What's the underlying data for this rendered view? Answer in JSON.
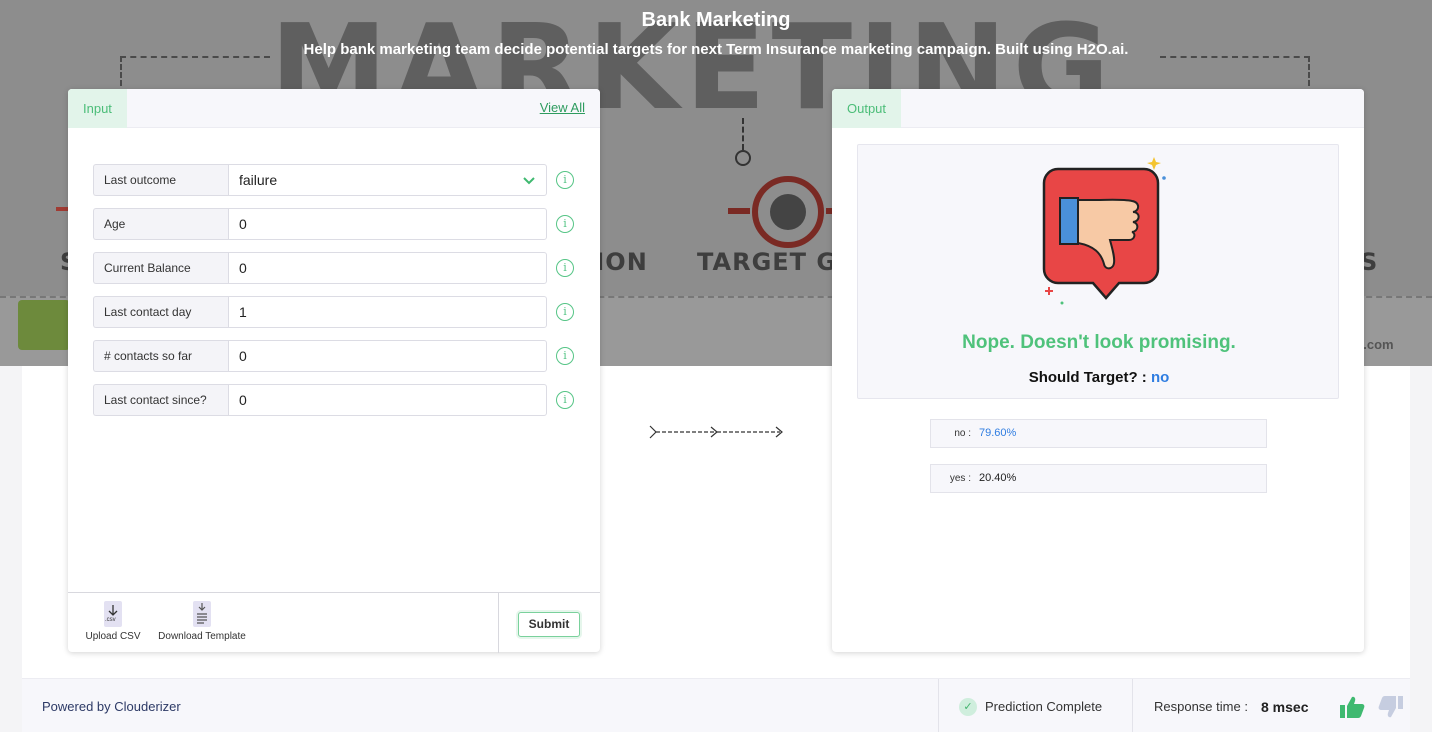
{
  "header": {
    "title": "Bank Marketing",
    "subtitle": "Help bank marketing team decide potential targets for next Term Insurance marketing campaign. Built using H2O.ai."
  },
  "hero": {
    "big_word": "MARKETING",
    "words": [
      "S",
      "TION",
      "TARGET GR",
      "S"
    ],
    "url_fragment": "e.com"
  },
  "input_panel": {
    "tab_label": "Input",
    "view_all": "View All",
    "fields": [
      {
        "label": "Last outcome",
        "value": "failure"
      },
      {
        "label": "Age",
        "value": "0"
      },
      {
        "label": "Current Balance",
        "value": "0"
      },
      {
        "label": "Last contact day",
        "value": "1"
      },
      {
        "label": "# contacts so far",
        "value": "0"
      },
      {
        "label": "Last contact since?",
        "value": "0"
      }
    ],
    "upload_csv": "Upload CSV",
    "download_template": "Download Template",
    "csv_badge": ".csv",
    "submit": "Submit"
  },
  "output_panel": {
    "tab_label": "Output",
    "message": "Nope. Doesn't look promising.",
    "should_target_label": "Should Target? :",
    "should_target_value": "no",
    "probabilities": [
      {
        "key": "no :",
        "value": "79.60%",
        "color": "#2f7de1"
      },
      {
        "key": "yes :",
        "value": "20.40%",
        "color": "#222222"
      }
    ]
  },
  "footer": {
    "powered_by": "Powered by Clouderizer",
    "status": "Prediction Complete",
    "response_label": "Response time :",
    "response_value": "8 msec"
  },
  "colors": {
    "accent_green": "#4fc27b",
    "link_blue": "#2f7de1",
    "thumb_red": "#e84646"
  }
}
